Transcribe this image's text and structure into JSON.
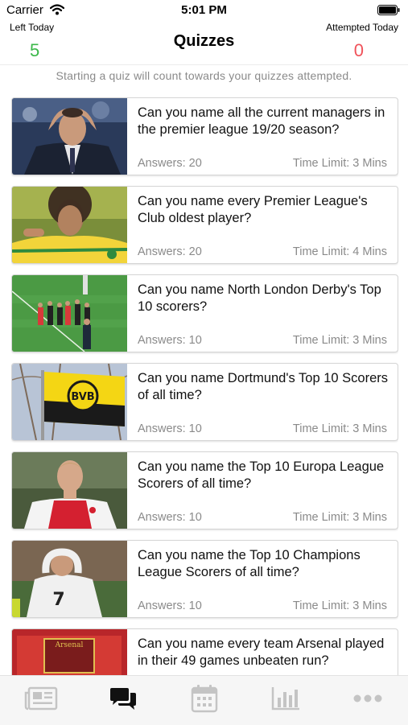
{
  "status_bar": {
    "carrier": "Carrier",
    "time": "5:01 PM"
  },
  "header": {
    "title": "Quizzes",
    "left_stat": {
      "label": "Left Today",
      "value": "5",
      "color": "#3cb84a"
    },
    "right_stat": {
      "label": "Attempted Today",
      "value": "0",
      "color": "#f0525a"
    },
    "notice": "Starting a quiz will count towards your quizzes attempted."
  },
  "quizzes": [
    {
      "title": "Can you name all the current managers in the premier league 19/20 season?",
      "answers": "Answers: 20",
      "time_limit": "Time Limit: 3 Mins"
    },
    {
      "title": "Can you name every Premier League's Club oldest player?",
      "answers": "Answers: 20",
      "time_limit": "Time Limit: 4 Mins"
    },
    {
      "title": "Can you name North London Derby's Top 10 scorers?",
      "answers": "Answers: 10",
      "time_limit": "Time Limit: 3 Mins"
    },
    {
      "title": "Can you name Dortmund's Top 10 Scorers of all time?",
      "answers": "Answers: 10",
      "time_limit": "Time Limit: 3 Mins"
    },
    {
      "title": "Can you name the Top 10 Europa League Scorers of all time?",
      "answers": "Answers: 10",
      "time_limit": "Time Limit: 3 Mins"
    },
    {
      "title": "Can you name the Top 10 Champions League Scorers of all time?",
      "answers": "Answers: 10",
      "time_limit": "Time Limit: 3 Mins"
    },
    {
      "title": "Can you name every team Arsenal played in their 49 games unbeaten run?",
      "answers": "",
      "time_limit": ""
    }
  ],
  "tab_bar": {
    "tabs": [
      {
        "icon": "newspaper-icon",
        "selected": false
      },
      {
        "icon": "chat-bubbles-icon",
        "selected": true
      },
      {
        "icon": "calendar-icon",
        "selected": false
      },
      {
        "icon": "bar-chart-icon",
        "selected": false
      },
      {
        "icon": "more-icon",
        "selected": false
      }
    ],
    "selected_color": "#111111",
    "unselected_color": "#c4c4c4"
  }
}
